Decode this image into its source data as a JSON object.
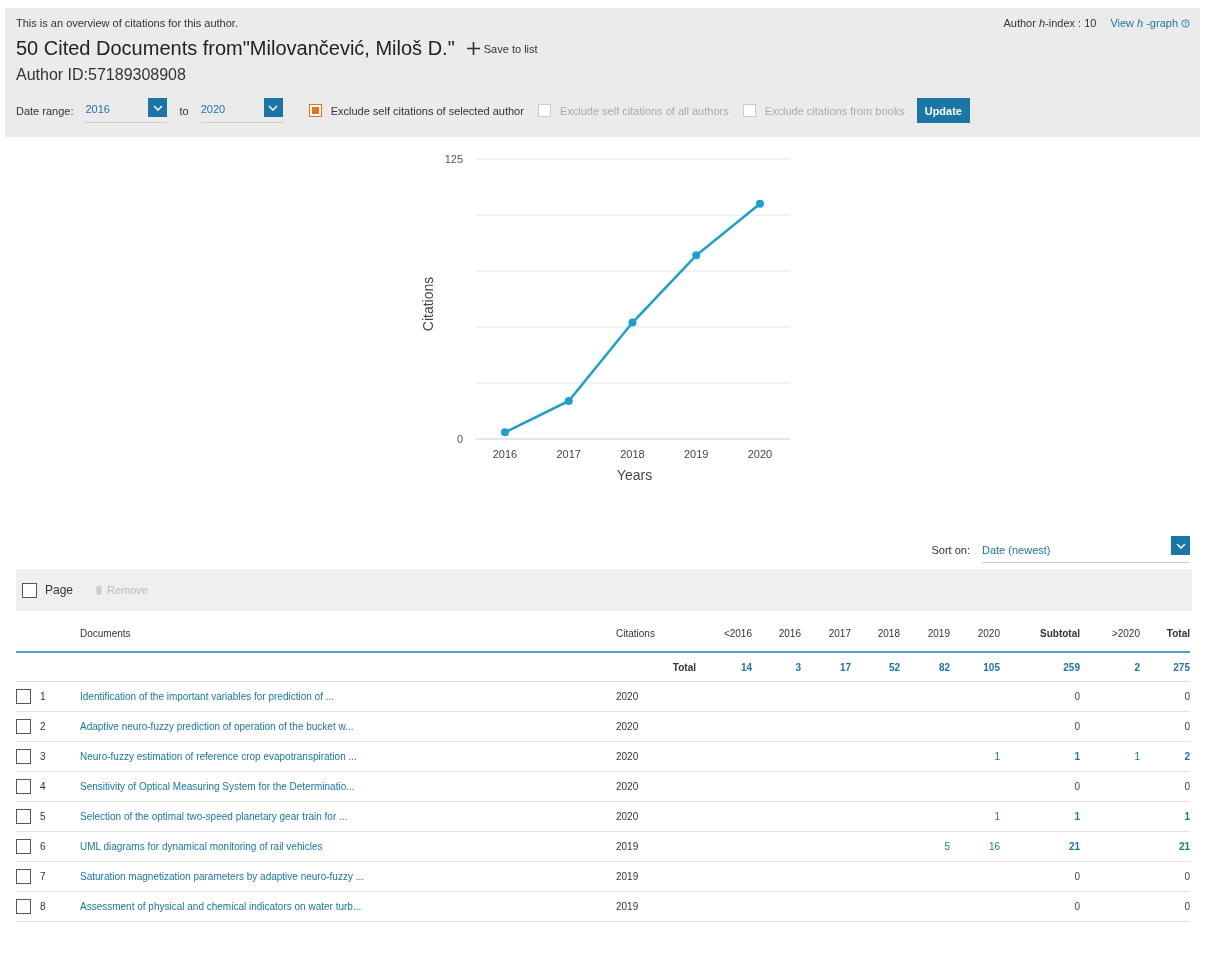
{
  "header": {
    "intro": "This is an overview of citations for this author.",
    "h_index": {
      "label": "Author *h*-index : 10",
      "link": "View *h*-graph"
    },
    "title": "50 Cited Documents from\"Milovančević, Miloš D.\"",
    "save_to_list": "Save to list",
    "author_id": "Author ID:57189308908"
  },
  "filters": {
    "date_range_label": "Date range:",
    "from": "2016",
    "to_label": "to",
    "to": "2020",
    "options": [
      {
        "label": "Exclude self citations of selected author",
        "checked": true,
        "disabled": false
      },
      {
        "label": "Exclude self citations of all authors",
        "checked": false,
        "disabled": true
      },
      {
        "label": "Exclude citations from books",
        "checked": false,
        "disabled": true
      }
    ],
    "update_button": "Update"
  },
  "chart": {
    "chart_data": {
      "type": "line",
      "xlabel": "Years",
      "ylabel": "Citations",
      "categories": [
        "2016",
        "2017",
        "2018",
        "2019",
        "2020"
      ],
      "series": [
        {
          "color": "#1a9fd0",
          "marker": "circle",
          "values": [
            3,
            17,
            52,
            82,
            105
          ]
        }
      ],
      "ylim": [
        0,
        125
      ],
      "yticks": [
        0,
        125
      ]
    }
  },
  "sort": {
    "label": "Sort on:",
    "value": "Date (newest)"
  },
  "toolbar": {
    "page_checkbox": {
      "label": "Page",
      "checked": false
    },
    "remove": {
      "label": "Remove",
      "disabled": true
    }
  },
  "table": {
    "columns": [
      "Documents",
      "Citations",
      "<2016",
      "2016",
      "2017",
      "2018",
      "2019",
      "2020",
      "Subtotal",
      ">2020",
      "Total"
    ],
    "total_row": {
      "label": "Total",
      "values": [
        "14",
        "3",
        "17",
        "52",
        "82",
        "105",
        "259",
        "2",
        "275"
      ]
    },
    "rows": [
      {
        "number": "1",
        "title": "Identification of the important variables for prediction of ...",
        "year": "2020",
        "checked": false,
        "values": {
          "subtotal": "0",
          "total": "0"
        }
      },
      {
        "number": "2",
        "title": "Adaptive neuro-fuzzy prediction of operation of the bucket w...",
        "year": "2020",
        "checked": false,
        "values": {
          "subtotal": "0",
          "total": "0"
        }
      },
      {
        "number": "3",
        "title": "Neuro-fuzzy estimation of reference crop evapotranspiration ...",
        "year": "2020",
        "checked": false,
        "values": {
          "y2020": "1",
          "subtotal": "1",
          "after_2020": "1",
          "total": "2"
        }
      },
      {
        "number": "4",
        "title": "Sensitivity of Optical Measuring System for the Determinatio...",
        "year": "2020",
        "checked": false,
        "values": {
          "subtotal": "0",
          "total": "0"
        }
      },
      {
        "number": "5",
        "title": "Selection of the optimal two-speed planetary gear train for ...",
        "year": "2020",
        "checked": false,
        "values": {
          "y2020": "1",
          "subtotal": "1",
          "total": "1"
        }
      },
      {
        "number": "6",
        "title": "UML diagrams for dynamical monitoring of rail vehicles",
        "year": "2019",
        "checked": false,
        "values": {
          "y2019": "5",
          "y2020": "16",
          "subtotal": "21",
          "total": "21"
        }
      },
      {
        "number": "7",
        "title": "Saturation magnetization parameters by adaptive neuro-fuzzy ...",
        "year": "2019",
        "checked": false,
        "values": {
          "subtotal": "0",
          "total": "0"
        }
      },
      {
        "number": "8",
        "title": "Assessment of physical and chemical indicators on water turb...",
        "year": "2019",
        "checked": false,
        "values": {
          "subtotal": "0",
          "total": "0"
        }
      }
    ]
  }
}
